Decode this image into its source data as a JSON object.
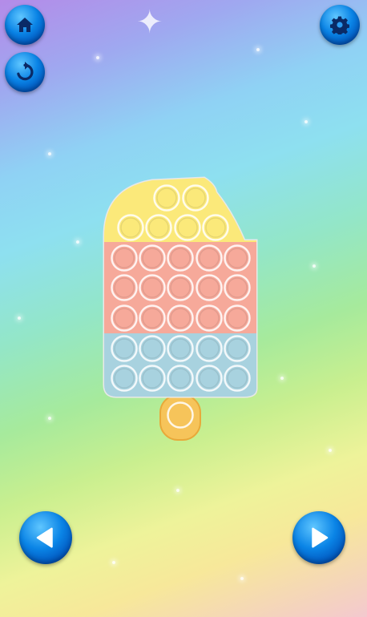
{
  "screen": {
    "background_theme": "pastel-rainbow-sparkle"
  },
  "buttons": {
    "home": {
      "icon": "home-icon"
    },
    "restart": {
      "icon": "restart-icon"
    },
    "settings": {
      "icon": "gear-icon"
    },
    "previous": {
      "icon": "arrow-left-icon"
    },
    "next": {
      "icon": "arrow-right-icon"
    }
  },
  "popit": {
    "shape": "popsicle",
    "rows": [
      {
        "color": "#fbe97a",
        "count": 2
      },
      {
        "color": "#fbe97a",
        "count": 4
      },
      {
        "color": "#f6a99a",
        "count": 5
      },
      {
        "color": "#f6a99a",
        "count": 5
      },
      {
        "color": "#f6a99a",
        "count": 5
      },
      {
        "color": "#a8d2df",
        "count": 5
      },
      {
        "color": "#a8d2df",
        "count": 5
      }
    ],
    "stick": {
      "color": "#f6c45a",
      "count": 1
    },
    "colors": {
      "yellow": "#fbe97a",
      "salmon": "#f6a99a",
      "blue": "#a8d2df",
      "orange_stick": "#f6c45a"
    }
  }
}
